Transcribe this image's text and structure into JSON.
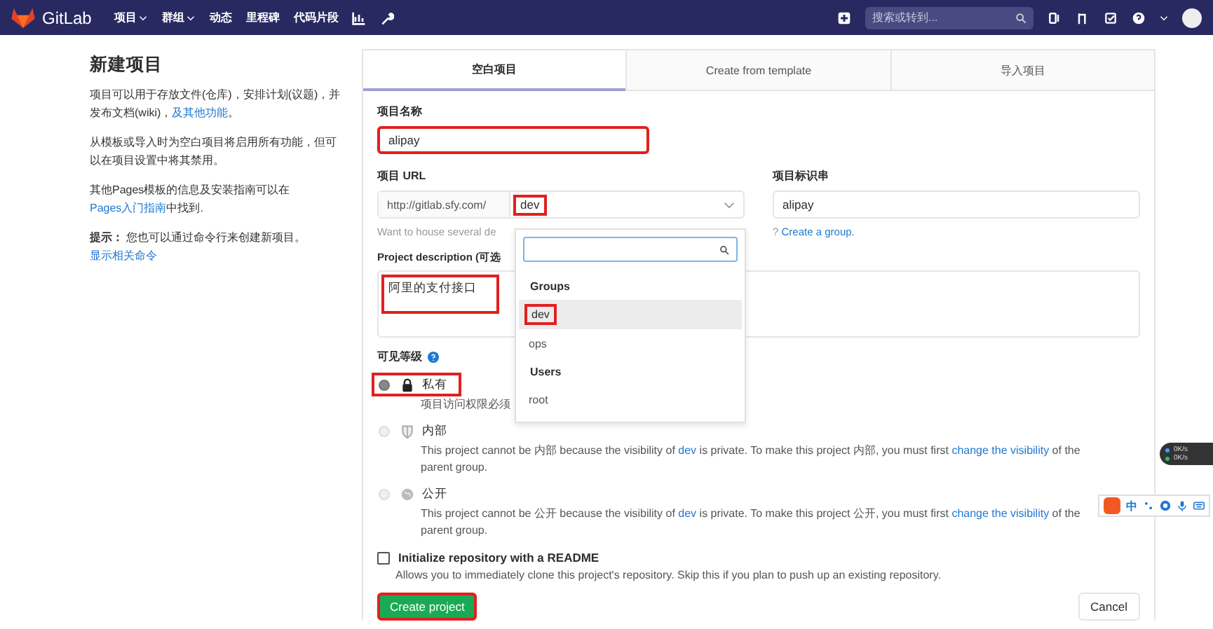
{
  "navbar": {
    "brand": "GitLab",
    "menu": [
      {
        "label": "项目",
        "dropdown": true
      },
      {
        "label": "群组",
        "dropdown": true
      },
      {
        "label": "动态",
        "dropdown": false
      },
      {
        "label": "里程碑",
        "dropdown": false
      },
      {
        "label": "代码片段",
        "dropdown": false
      }
    ],
    "search": {
      "placeholder": "搜索或转到..."
    }
  },
  "intro": {
    "title": "新建项目",
    "paragraphs": [
      {
        "text": "项目可以用于存放文件(仓库)，安排计划(议题)，并发布文档(wiki)，",
        "link": "及其他功能",
        "after": "。"
      },
      {
        "text": "从模板或导入时为空白项目将启用所有功能，但可以在项目设置中将其禁用。"
      },
      {
        "text": "其他Pages模板的信息及安装指南可以在",
        "link": "Pages入门指南",
        "after": "中找到."
      },
      {
        "text": "**提示：** 您也可以通过命令行来创建新项目。",
        "link": "显示相关命令"
      }
    ]
  },
  "tabs": [
    {
      "label": "空白项目",
      "selected": true
    },
    {
      "label": "Create from template",
      "selected": false
    },
    {
      "label": "导入项目",
      "selected": false
    }
  ],
  "form": {
    "name_label": "项目名称",
    "name_value": "alipay",
    "name_highlighted": true,
    "url_label": "项目 URL",
    "url_prefix": "http://gitlab.sfy.com/",
    "namespace_value": "dev",
    "namespace_highlighted": true,
    "slug_label": "项目标识串",
    "slug_value": "alipay",
    "group_hint": "Want to house several de",
    "group_hint_tail": "? ",
    "group_link": "Create a group.",
    "desc_label": "Project description (可选",
    "desc_value": "阿里的支付接口",
    "desc_highlighted": true,
    "visibility_label": "可见等级",
    "visibility": [
      {
        "kind": "lock",
        "label": "私有",
        "selected": true,
        "disabled": false,
        "highlighted": true,
        "lines": [
          {
            "text": "项目访问权限必须"
          }
        ]
      },
      {
        "kind": "shield",
        "label": "内部",
        "selected": false,
        "disabled": true,
        "highlighted": false,
        "lines": [
          {
            "text": "This project cannot be 内部 because the visibility of ",
            "link": "dev",
            "after": " is private. To make this project 内部, you must first "
          },
          {
            "link": "change the visibility",
            "after": " of the parent group."
          }
        ]
      },
      {
        "kind": "globe",
        "label": "公开",
        "selected": false,
        "disabled": true,
        "highlighted": false,
        "lines": [
          {
            "text": "This project cannot be 公开 because the visibility of ",
            "link": "dev",
            "after": " is private. To make this project 公开, you must first "
          },
          {
            "link": "change the visibility",
            "after": " of the parent group."
          }
        ]
      }
    ],
    "readme_label": "Initialize repository with a README",
    "readme_checked": false,
    "readme_help": "Allows you to immediately clone this project's repository. Skip this if you plan to push up an existing repository.",
    "create_button": "Create project",
    "create_highlighted": true,
    "cancel_button": "Cancel"
  },
  "dropdown": {
    "sections": [
      {
        "header": "Groups",
        "items": [
          {
            "label": "dev",
            "selected": true,
            "highlighted": true
          },
          {
            "label": "ops",
            "selected": false,
            "highlighted": false
          }
        ]
      },
      {
        "header": "Users",
        "items": [
          {
            "label": "root",
            "selected": false,
            "highlighted": false
          }
        ]
      }
    ]
  },
  "ime_toolbar": {
    "label": "中"
  },
  "net_widget": {
    "readings": [
      "0K/s",
      "0K/s"
    ]
  }
}
